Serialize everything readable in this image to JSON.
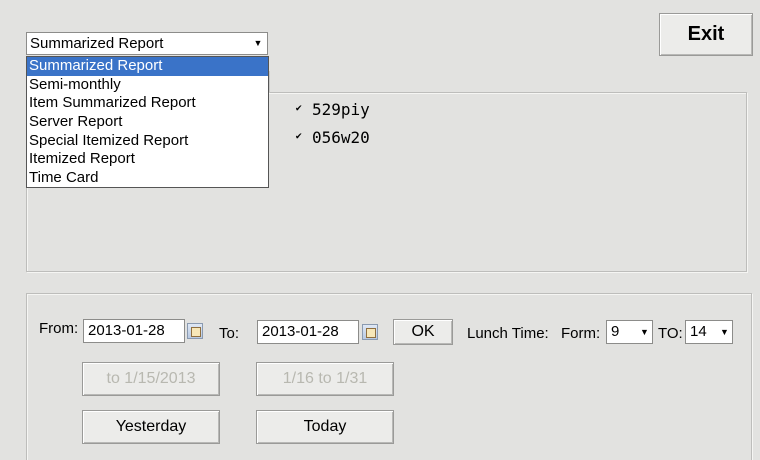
{
  "header": {
    "exit_label": "Exit"
  },
  "report_select": {
    "value": "Summarized Report",
    "options": [
      "Summarized Report",
      "Semi-monthly",
      "Item Summarized Report",
      "Server Report",
      "Special Itemized Report",
      "Itemized Report",
      "Time Card"
    ],
    "selected_index": 0
  },
  "servers": [
    {
      "id": "529piy",
      "checked": true
    },
    {
      "id": "056w20",
      "checked": true
    }
  ],
  "range": {
    "from_label": "From:",
    "from_value": "2013-01-28",
    "to_label": "To:",
    "to_value": "2013-01-28",
    "ok_label": "OK"
  },
  "lunch": {
    "label": "Lunch Time:",
    "form_label": "Form:",
    "form_value": "9",
    "to_label": "TO:",
    "to_value": "14"
  },
  "quick_buttons": {
    "first_half": "to 1/15/2013",
    "second_half": "1/16 to 1/31",
    "yesterday": "Yesterday",
    "today": "Today"
  }
}
